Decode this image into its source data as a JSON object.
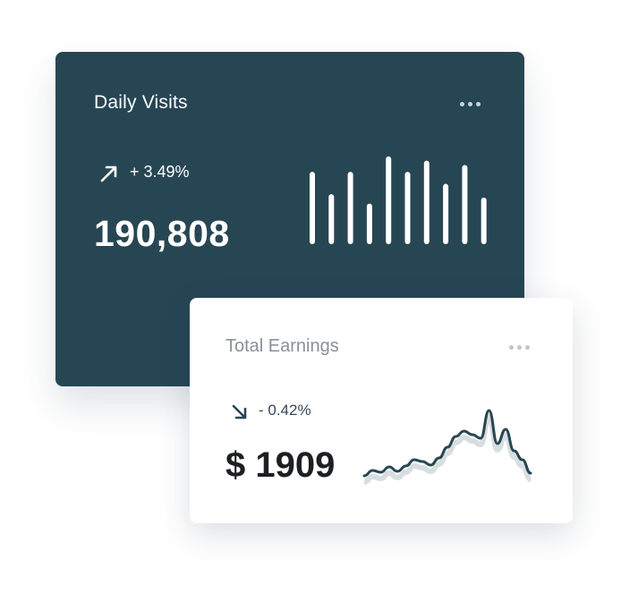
{
  "daily_visits": {
    "title": "Daily Visits",
    "menu_icon": "more-horizontal-icon",
    "trend_icon": "arrow-up-right-icon",
    "change": "+ 3.49%",
    "value": "190,808",
    "colors": {
      "card_bg": "#274654",
      "text": "#ffffff"
    }
  },
  "total_earnings": {
    "title": "Total Earnings",
    "menu_icon": "more-horizontal-icon",
    "trend_icon": "arrow-down-right-icon",
    "change": "- 0.42%",
    "value": "$ 1909",
    "colors": {
      "card_bg": "#ffffff",
      "line": "#274654"
    }
  },
  "chart_data": [
    {
      "type": "bar",
      "values": [
        78,
        52,
        78,
        41,
        96,
        78,
        91,
        64,
        86,
        48
      ],
      "ylim": [
        0,
        100
      ]
    },
    {
      "type": "line",
      "values": [
        2,
        8,
        6,
        12,
        7,
        13,
        20,
        18,
        14,
        22,
        34,
        46,
        52,
        48,
        44,
        75,
        38,
        54,
        30,
        20,
        5
      ],
      "ylim": [
        0,
        80
      ]
    }
  ]
}
